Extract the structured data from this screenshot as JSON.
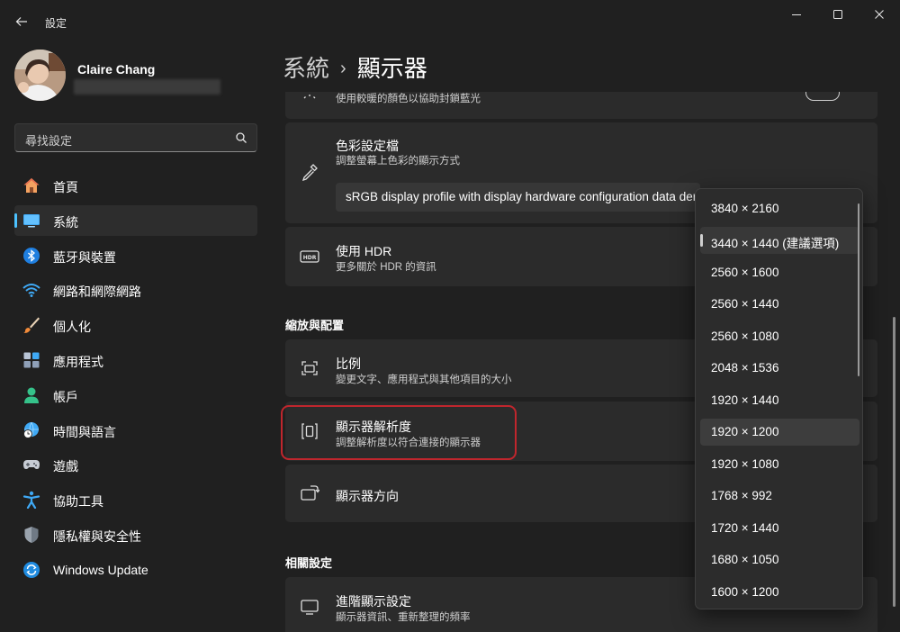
{
  "window": {
    "title": "設定"
  },
  "user": {
    "name": "Claire Chang"
  },
  "search": {
    "placeholder": "尋找設定"
  },
  "sidebar": {
    "items": [
      {
        "label": "首頁",
        "icon": "home-icon"
      },
      {
        "label": "系統",
        "icon": "system-icon",
        "active": true
      },
      {
        "label": "藍牙與裝置",
        "icon": "bluetooth-icon"
      },
      {
        "label": "網路和網際網路",
        "icon": "wifi-icon"
      },
      {
        "label": "個人化",
        "icon": "brush-icon"
      },
      {
        "label": "應用程式",
        "icon": "apps-icon"
      },
      {
        "label": "帳戶",
        "icon": "account-icon"
      },
      {
        "label": "時間與語言",
        "icon": "clock-globe-icon"
      },
      {
        "label": "遊戲",
        "icon": "gamepad-icon"
      },
      {
        "label": "協助工具",
        "icon": "accessibility-icon"
      },
      {
        "label": "隱私權與安全性",
        "icon": "shield-icon"
      },
      {
        "label": "Windows Update",
        "icon": "update-icon"
      }
    ]
  },
  "breadcrumb": {
    "parent": "系統",
    "separator": "›",
    "current": "顯示器"
  },
  "cards": {
    "night_light_sub": "使用較暖的顏色以協助封鎖藍光",
    "color_profile": {
      "title": "色彩設定檔",
      "sub": "調整螢幕上色彩的顯示方式",
      "value": "sRGB display profile with display hardware configuration data derived from EDID"
    },
    "hdr": {
      "title": "使用 HDR",
      "sub": "更多關於 HDR 的資訊"
    },
    "scale": {
      "title": "比例",
      "sub": "變更文字、應用程式與其他項目的大小"
    },
    "resolution": {
      "title": "顯示器解析度",
      "sub": "調整解析度以符合連接的顯示器"
    },
    "orientation": {
      "title": "顯示器方向"
    },
    "advanced": {
      "title": "進階顯示設定",
      "sub": "顯示器資訊、重新整理的頻率"
    }
  },
  "sections": {
    "scale_layout": "縮放與配置",
    "related": "相關設定"
  },
  "resolution_dropdown": {
    "options": [
      "3840 × 2160",
      "3440 × 1440 (建議選項)",
      "2560 × 1600",
      "2560 × 1440",
      "2560 × 1080",
      "2048 × 1536",
      "1920 × 1440",
      "1920 × 1200",
      "1920 × 1080",
      "1768 × 992",
      "1720 × 1440",
      "1680 × 1050",
      "1600 × 1200"
    ],
    "selected_index": 1,
    "hovered_index": 7
  },
  "colors": {
    "background": "#202020",
    "card": "#2b2b2b",
    "accent": "#4cc2ff",
    "highlight": "#c0262d"
  }
}
